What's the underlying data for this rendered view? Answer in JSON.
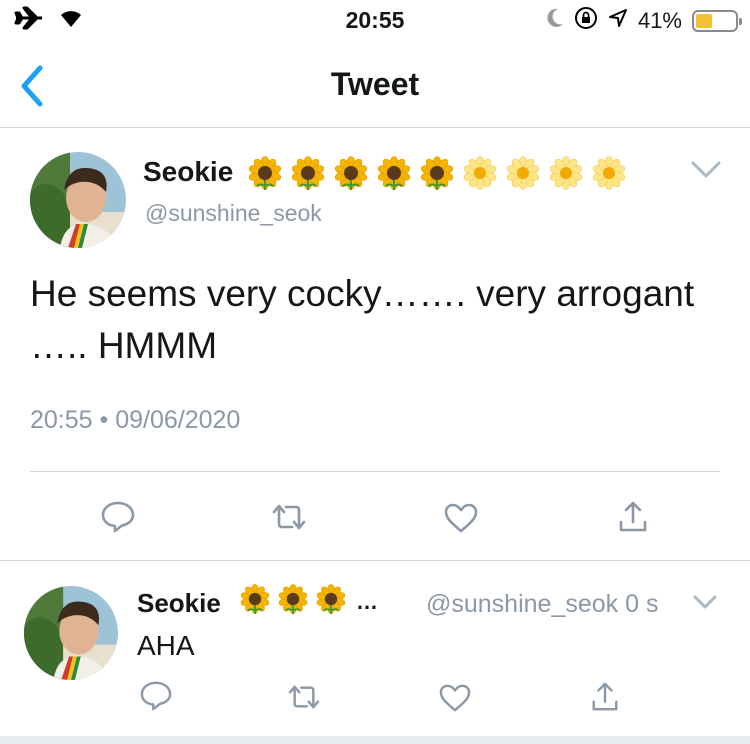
{
  "status_bar": {
    "time": "20:55",
    "battery_percent": "41%",
    "battery_level": 0.41,
    "battery_color": "#f2c232",
    "icons": [
      "airplane-icon",
      "wifi-icon",
      "moon-icon",
      "rotation-lock-icon",
      "location-icon",
      "battery-icon"
    ]
  },
  "nav": {
    "title": "Tweet",
    "back_icon": "chevron-left-icon",
    "accent_color": "#1da1f2"
  },
  "tweet": {
    "display_name": "Seokie",
    "name_emojis": [
      "sunflower",
      "sunflower",
      "sunflower",
      "sunflower",
      "sunflower",
      "blossom",
      "blossom",
      "blossom",
      "blossom"
    ],
    "handle": "@sunshine_seok",
    "text": "He seems very cocky……. very arrogant ….. HMMM",
    "timestamp": "20:55 • 09/06/2020",
    "actions": [
      "reply-icon",
      "retweet-icon",
      "like-icon",
      "share-icon"
    ]
  },
  "reply": {
    "display_name": "Seokie",
    "name_emojis": [
      "sunflower",
      "sunflower",
      "sunflower"
    ],
    "ellipsis": "…",
    "handle_time": "@sunshine_seok 0 s",
    "text": "AHA",
    "actions": [
      "reply-icon",
      "retweet-icon",
      "like-icon",
      "share-icon"
    ]
  }
}
